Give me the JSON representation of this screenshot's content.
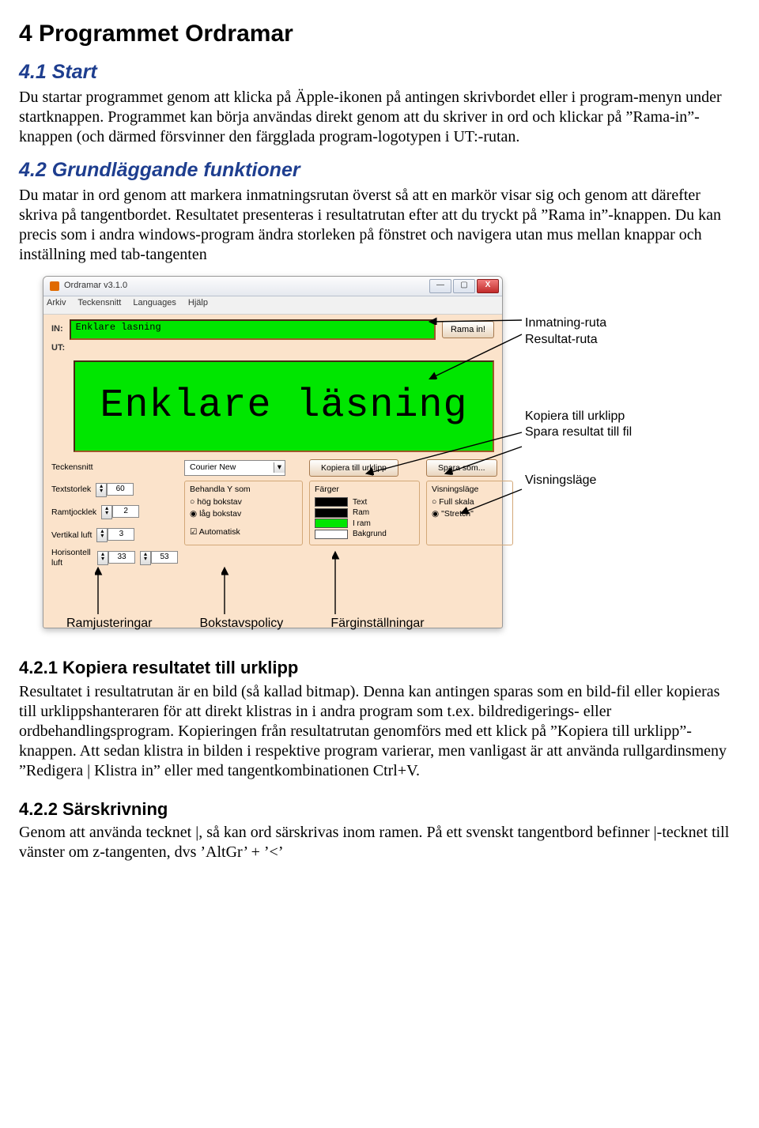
{
  "sec4": {
    "title": "4 Programmet Ordramar",
    "s41_title": "4.1 Start",
    "s41_body": "Du startar programmet genom att klicka på Äpple-ikonen på antingen skrivbordet eller i program-menyn under startknappen. Programmet kan börja användas direkt genom att du skriver in ord och klickar på ”Rama-in”-knappen (och därmed försvinner den färgglada program-logotypen i UT:-rutan.",
    "s42_title": "4.2 Grundläggande funktioner",
    "s42_body": "Du matar in ord genom att markera inmatningsrutan överst så att en markör visar sig och genom att därefter skriva på tangentbordet. Resultatet presenteras i resultatrutan efter att du tryckt på ”Rama in”-knappen. Du kan precis som i andra windows-program ändra storleken på fönstret och navigera utan mus mellan knappar och inställning med tab-tangenten",
    "s421_title": "4.2.1 Kopiera resultatet till urklipp",
    "s421_body": "Resultatet i resultatrutan är en bild (så kallad bitmap). Denna kan antingen sparas som en bild-fil eller kopieras till urklippshanteraren för att direkt klistras in i andra program som t.ex. bildredigerings- eller ordbehandlingsprogram. Kopieringen från resultatrutan genomförs med ett klick på ”Kopiera till urklipp”-knappen. Att sedan klistra in bilden i respektive program varierar, men vanligast är att använda rullgardinsmeny ”Redigera | Klistra in” eller med tangentkombinationen Ctrl+V.",
    "s422_title": "4.2.2 Särskrivning",
    "s422_body": "Genom att använda tecknet |, så kan ord särskrivas inom ramen. På ett svenskt tangentbord befinner |-tecknet till vänster om z-tangenten, dvs ’AltGr’ + ’<’"
  },
  "win": {
    "title": "Ordramar v3.1.0",
    "menu": {
      "arkiv": "Arkiv",
      "teck": "Teckensnitt",
      "lang": "Languages",
      "hjalp": "Hjälp"
    },
    "in_label": "IN:",
    "ut_label": "UT:",
    "in_value": "Enklare lasning",
    "rama_btn": "Rama in!",
    "out_text": "Enklare läsning",
    "copy_btn": "Kopiera till urklipp",
    "save_btn": "Spara som...",
    "font_label": "Teckensnitt",
    "font_value": "Courier New",
    "size_label": "Textstorlek",
    "size_value": "60",
    "thick_label": "Ramtjocklek",
    "thick_value": "2",
    "vair_label": "Vertikal luft",
    "vair_value": "3",
    "hair_label": "Horisontell luft",
    "hair_value1": "33",
    "hair_value2": "53",
    "behandla_title": "Behandla Y som",
    "hog": "hög bokstav",
    "lag": "låg bokstav",
    "auto": "Automatisk",
    "farger_title": "Färger",
    "c_text": "Text",
    "c_ram": "Ram",
    "c_iram": "I ram",
    "c_bak": "Bakgrund",
    "vis_title": "Visningsläge",
    "vis_full": "Full skala",
    "vis_stretch": "\"Stretch\""
  },
  "callouts": {
    "right1a": "Inmatning-ruta",
    "right1b": "Resultat-ruta",
    "right2a": "Kopiera till urklipp",
    "right2b": "Spara resultat till fil",
    "right3": "Visningsläge",
    "bot1": "Ramjusteringar",
    "bot2": "Bokstavspolicy",
    "bot3": "Färginställningar"
  }
}
